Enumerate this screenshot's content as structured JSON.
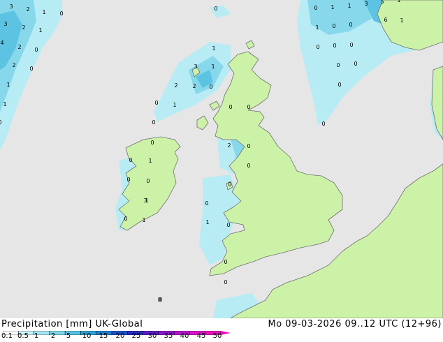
{
  "footer": {
    "title": "Precipitation [mm]  UK-Global",
    "datetime": "Mo 09-03-2026 09..12 UTC (12+96)"
  },
  "scale": {
    "labels": [
      "0.1",
      "0.5",
      "1",
      "2",
      "5",
      "10",
      "15",
      "20",
      "25",
      "30",
      "35",
      "40",
      "45",
      "50"
    ],
    "colors": [
      "#ffffff",
      "#c8f0f8",
      "#a6e6f2",
      "#7fd6ea",
      "#54c2e2",
      "#2ea4d6",
      "#1a7fd0",
      "#1a52c8",
      "#2a2ac0",
      "#5a1ec8",
      "#8a18cc",
      "#b814cc",
      "#d812c8",
      "#ee10bc"
    ]
  },
  "colors": {
    "sea": "#e6e6e6",
    "land": "#ccf2a8",
    "light_rain": "#b8ecf4",
    "moderate_rain": "#88d8ec",
    "heavy_rain": "#5cc4e2",
    "coast": "#707070"
  },
  "values": [
    {
      "t": "3"
    },
    {
      "t": "2"
    },
    {
      "t": "1"
    },
    {
      "t": "0"
    },
    {
      "t": "3"
    },
    {
      "t": "2"
    },
    {
      "t": "1"
    },
    {
      "t": "4"
    },
    {
      "t": "2"
    },
    {
      "t": "0"
    },
    {
      "t": "2"
    },
    {
      "t": "0"
    },
    {
      "t": "1"
    },
    {
      "t": "1"
    },
    {
      "t": "0"
    },
    {
      "t": "0"
    },
    {
      "t": "0"
    },
    {
      "t": "1"
    },
    {
      "t": "1"
    },
    {
      "t": "3"
    },
    {
      "t": "5"
    },
    {
      "t": "1"
    },
    {
      "t": "1"
    },
    {
      "t": "0"
    },
    {
      "t": "0"
    },
    {
      "t": "6"
    },
    {
      "t": "1"
    },
    {
      "t": "0"
    },
    {
      "t": "0"
    },
    {
      "t": "0"
    },
    {
      "t": "0"
    },
    {
      "t": "0"
    },
    {
      "t": "0"
    },
    {
      "t": "0"
    },
    {
      "t": "1"
    },
    {
      "t": "3"
    },
    {
      "t": "1"
    },
    {
      "t": "2"
    },
    {
      "t": "2"
    },
    {
      "t": "0"
    },
    {
      "t": "0"
    },
    {
      "t": "1"
    },
    {
      "t": "0"
    },
    {
      "t": "0"
    },
    {
      "t": "0"
    },
    {
      "t": "0"
    },
    {
      "t": "2"
    },
    {
      "t": "0"
    },
    {
      "t": "0"
    },
    {
      "t": "1"
    },
    {
      "t": "0"
    },
    {
      "t": "0"
    },
    {
      "t": "0"
    },
    {
      "t": "0"
    },
    {
      "t": "0"
    },
    {
      "t": "1"
    },
    {
      "t": "3"
    },
    {
      "t": "0"
    },
    {
      "t": "1"
    },
    {
      "t": "0"
    },
    {
      "t": "1"
    },
    {
      "t": "0"
    },
    {
      "t": "0"
    },
    {
      "t": "0"
    },
    {
      "t": "0"
    }
  ]
}
